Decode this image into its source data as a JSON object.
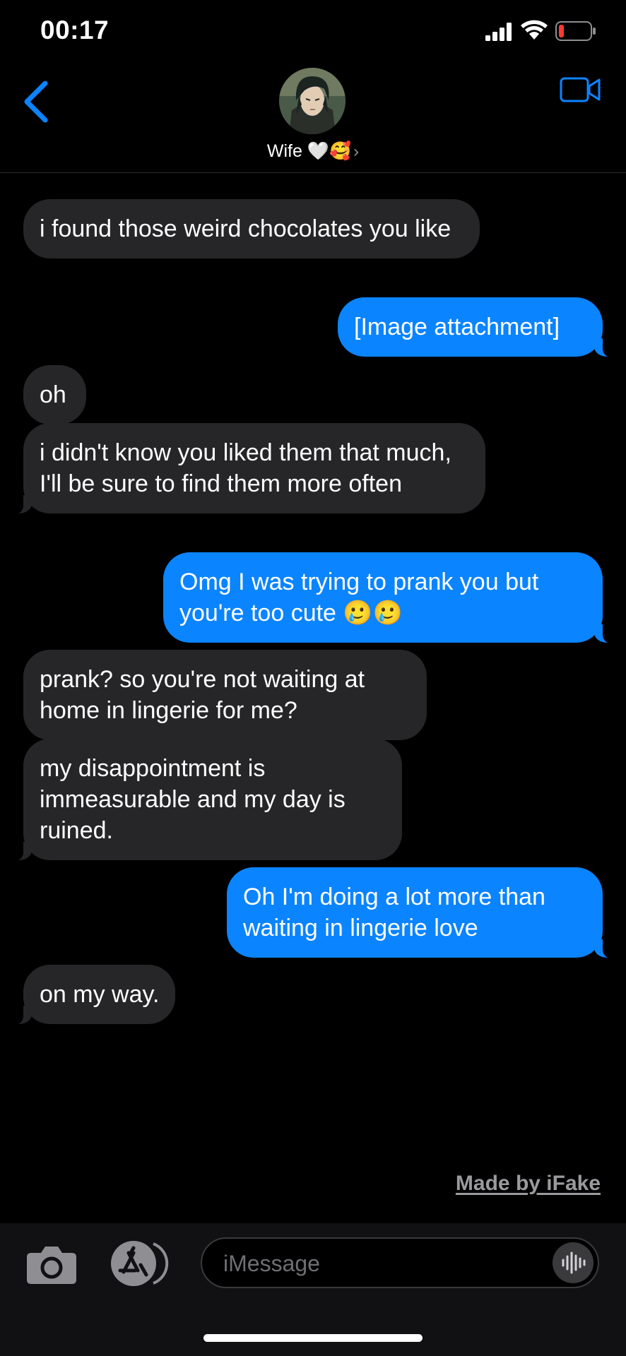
{
  "status_bar": {
    "time": "00:17",
    "icons": [
      "signal-icon",
      "wifi-icon",
      "battery-low-icon"
    ],
    "battery_color": "#ff3b30"
  },
  "header": {
    "contact_name": "Wife 🤍🥰",
    "chevron": "›",
    "back_icon": "chevron-left-icon",
    "video_icon": "video-camera-icon",
    "accent_color": "#0b84ff"
  },
  "messages": [
    {
      "direction": "received",
      "text": "i found those weird chocolates you like"
    },
    {
      "direction": "sent",
      "text": "[Image attachment]"
    },
    {
      "direction": "received",
      "text": "oh"
    },
    {
      "direction": "received",
      "text": "i didn't know you liked them that much, I'll be sure to find them more often"
    },
    {
      "direction": "sent",
      "text": "Omg I was trying to prank you but you're too cute 🥲🥲"
    },
    {
      "direction": "received",
      "text": "prank? so you're not waiting at home in lingerie for me?"
    },
    {
      "direction": "received",
      "text": "my disappointment is immeasurable and my day is ruined."
    },
    {
      "direction": "sent",
      "text": "Oh I'm doing a lot more than waiting in lingerie love"
    },
    {
      "direction": "received",
      "text": "on my way."
    }
  ],
  "watermark": "Made by iFake",
  "composer": {
    "placeholder": "iMessage",
    "camera_icon": "camera-icon",
    "apps_icon": "app-store-icon",
    "audio_icon": "audio-waveform-icon"
  },
  "colors": {
    "sent_bubble": "#0b84ff",
    "received_bubble": "#262628",
    "background": "#000000"
  }
}
